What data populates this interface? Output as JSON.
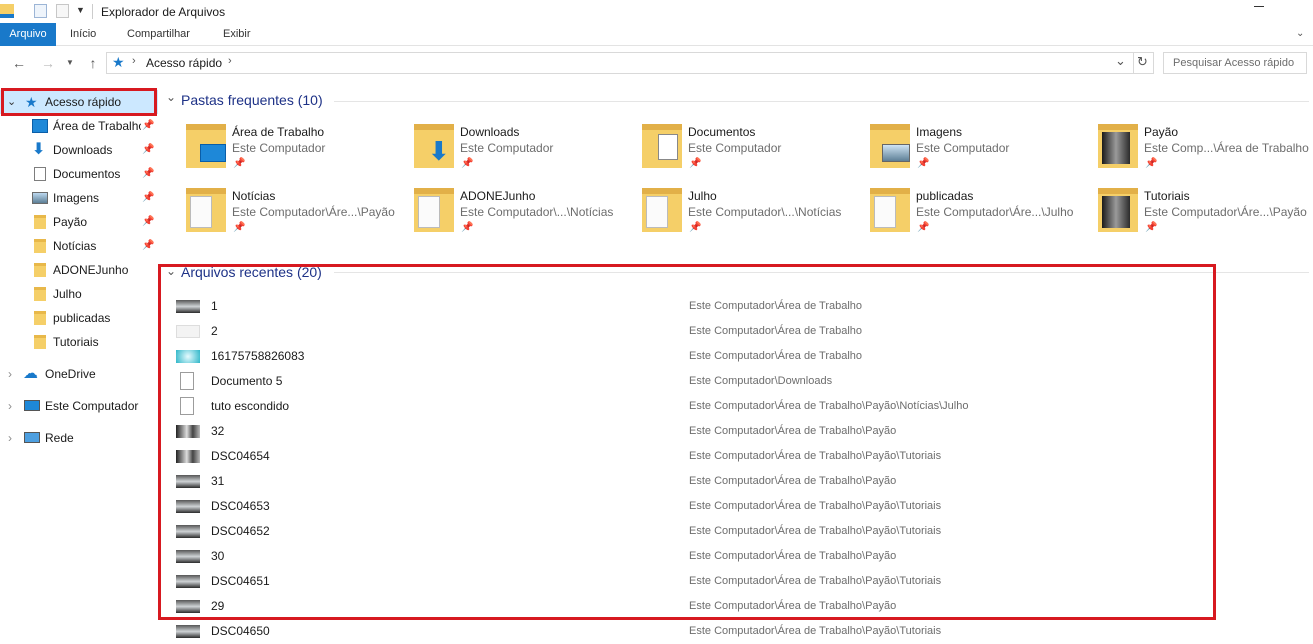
{
  "window": {
    "title": "Explorador de Arquivos"
  },
  "ribbon": {
    "tabs": [
      "Arquivo",
      "Início",
      "Compartilhar",
      "Exibir"
    ]
  },
  "address": {
    "crumb": "Acesso rápido",
    "search_placeholder": "Pesquisar Acesso rápido"
  },
  "nav": {
    "quick_access": "Acesso rápido",
    "items": [
      {
        "label": "Área de Trabalho",
        "pinned": true
      },
      {
        "label": "Downloads",
        "pinned": true
      },
      {
        "label": "Documentos",
        "pinned": true
      },
      {
        "label": "Imagens",
        "pinned": true
      },
      {
        "label": "Payão",
        "pinned": true
      },
      {
        "label": "Notícias",
        "pinned": true
      },
      {
        "label": "ADONEJunho",
        "pinned": false
      },
      {
        "label": "Julho",
        "pinned": false
      },
      {
        "label": "publicadas",
        "pinned": false
      },
      {
        "label": "Tutoriais",
        "pinned": false
      }
    ],
    "onedrive": "OneDrive",
    "computer": "Este Computador",
    "network": "Rede"
  },
  "frequent": {
    "title": "Pastas frequentes (10)",
    "folders": [
      {
        "name": "Área de Trabalho",
        "path": "Este Computador"
      },
      {
        "name": "Downloads",
        "path": "Este Computador"
      },
      {
        "name": "Documentos",
        "path": "Este Computador"
      },
      {
        "name": "Imagens",
        "path": "Este Computador"
      },
      {
        "name": "Payão",
        "path": "Este Comp...\\Área de Trabalho"
      },
      {
        "name": "Notícias",
        "path": "Este Computador\\Áre...\\Payão"
      },
      {
        "name": "ADONEJunho",
        "path": "Este Computador\\...\\Notícias"
      },
      {
        "name": "Julho",
        "path": "Este Computador\\...\\Notícias"
      },
      {
        "name": "publicadas",
        "path": "Este Computador\\Áre...\\Julho"
      },
      {
        "name": "Tutoriais",
        "path": "Este Computador\\Áre...\\Payão"
      }
    ]
  },
  "recent": {
    "title": "Arquivos recentes (20)",
    "files": [
      {
        "name": "1",
        "path": "Este Computador\\Área de Trabalho"
      },
      {
        "name": "2",
        "path": "Este Computador\\Área de Trabalho"
      },
      {
        "name": "16175758826083",
        "path": "Este Computador\\Área de Trabalho"
      },
      {
        "name": "Documento 5",
        "path": "Este Computador\\Downloads"
      },
      {
        "name": "tuto escondido",
        "path": "Este Computador\\Área de Trabalho\\Payão\\Notícias\\Julho"
      },
      {
        "name": "32",
        "path": "Este Computador\\Área de Trabalho\\Payão"
      },
      {
        "name": "DSC04654",
        "path": "Este Computador\\Área de Trabalho\\Payão\\Tutoriais"
      },
      {
        "name": "31",
        "path": "Este Computador\\Área de Trabalho\\Payão"
      },
      {
        "name": "DSC04653",
        "path": "Este Computador\\Área de Trabalho\\Payão\\Tutoriais"
      },
      {
        "name": "DSC04652",
        "path": "Este Computador\\Área de Trabalho\\Payão\\Tutoriais"
      },
      {
        "name": "30",
        "path": "Este Computador\\Área de Trabalho\\Payão"
      },
      {
        "name": "DSC04651",
        "path": "Este Computador\\Área de Trabalho\\Payão\\Tutoriais"
      },
      {
        "name": "29",
        "path": "Este Computador\\Área de Trabalho\\Payão"
      },
      {
        "name": "DSC04650",
        "path": "Este Computador\\Área de Trabalho\\Payão\\Tutoriais"
      }
    ]
  },
  "colors": {
    "accent": "#1979ca",
    "highlight": "#cce8ff",
    "annotation": "#d71920",
    "section": "#1e3287"
  }
}
